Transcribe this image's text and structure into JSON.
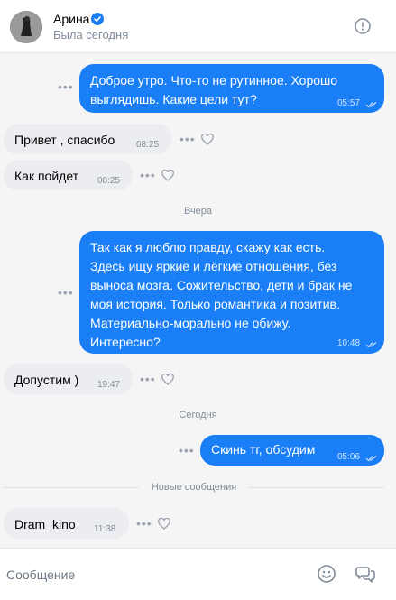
{
  "header": {
    "name": "Арина",
    "status": "Была сегодня"
  },
  "messages": [
    {
      "dir": "out",
      "text_lines": [
        "Доброе утро. Что-то не рутинное. Хорошо",
        "выглядишь. Какие цели тут?"
      ],
      "time": "05:57"
    },
    {
      "dir": "in",
      "text": "Привет , спасибо",
      "time": "08:25"
    },
    {
      "dir": "in",
      "text": "Как пойдет",
      "time": "08:25"
    },
    {
      "dir": "sep",
      "text": "Вчера"
    },
    {
      "dir": "out",
      "text_lines": [
        "Так как я люблю правду, скажу как есть.",
        "Здесь ищу яркие и лёгкие отношения, без",
        "выноса мозга. Сожительство, дети и брак не",
        "моя история. Только романтика и позитив.",
        "Материально-морально не обижу.",
        "Интересно?"
      ],
      "time": "10:48"
    },
    {
      "dir": "in",
      "text": "Допустим )",
      "time": "19:47"
    },
    {
      "dir": "sep",
      "text": "Сегодня"
    },
    {
      "dir": "out",
      "text_lines": [
        "Скинь тг, обсудим"
      ],
      "time": "05:06"
    },
    {
      "dir": "newsep",
      "text": "Новые сообщения"
    },
    {
      "dir": "in",
      "text": "Dram_kino",
      "time": "11:38"
    }
  ],
  "composer": {
    "placeholder": "Сообщение"
  },
  "icons": {
    "more": "dots-icon",
    "like": "heart-icon",
    "info": "info-icon",
    "emoji": "smile-icon",
    "templates": "chat-bubbles-icon",
    "verified": "verified-check-icon",
    "read": "double-check-icon"
  },
  "colors": {
    "accent": "#1a7ff6",
    "incoming": "#ebedf0",
    "background": "#f5f5f6"
  }
}
